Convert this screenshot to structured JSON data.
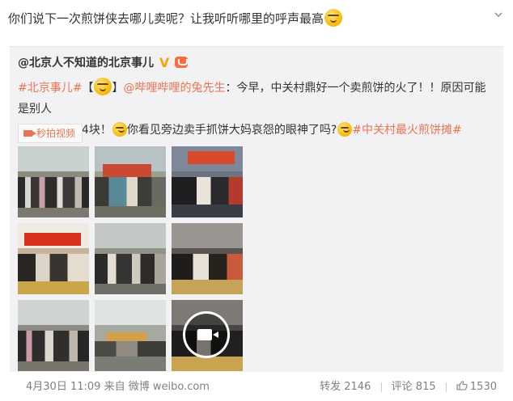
{
  "post": {
    "text": "你们说下一次煎饼侠去哪儿卖呢？让我听听哪里的呼声最高"
  },
  "repost": {
    "author": "@北京人不知道的北京事儿",
    "verified_badge": "V",
    "tag_beijing": "#北京事儿#",
    "bracket_open": "【",
    "bracket_close": "】",
    "mention": "@哔哩哔哩的兔先生",
    "text_1": "：今早，中关村鼎好一个卖煎饼的火了！！原因可能是别人",
    "text_2": "卖5块，他卖4块！",
    "text_3": "你看见旁边卖手抓饼大妈哀怨的眼神了吗?",
    "tag_zgc": "#中关村最火煎饼摊#",
    "video_link": "秒拍视频"
  },
  "footer": {
    "time": "4月30日 11:09",
    "source_prefix": "来自",
    "source": "微博 weibo.com",
    "repost_label": "转发",
    "repost_count": "2146",
    "comment_label": "评论",
    "comment_count": "815",
    "like_count": "1530"
  },
  "colors": {
    "link": "#eb7350",
    "card_bg": "#f2f2f5",
    "meta": "#808080"
  },
  "icons": [
    "chevron-down-icon",
    "emoji-smirk-icon",
    "verified-v-icon",
    "vip-crown-icon",
    "emoji-laugh-icon",
    "emoji-cat-icon",
    "video-icon",
    "play-icon",
    "like-icon"
  ]
}
